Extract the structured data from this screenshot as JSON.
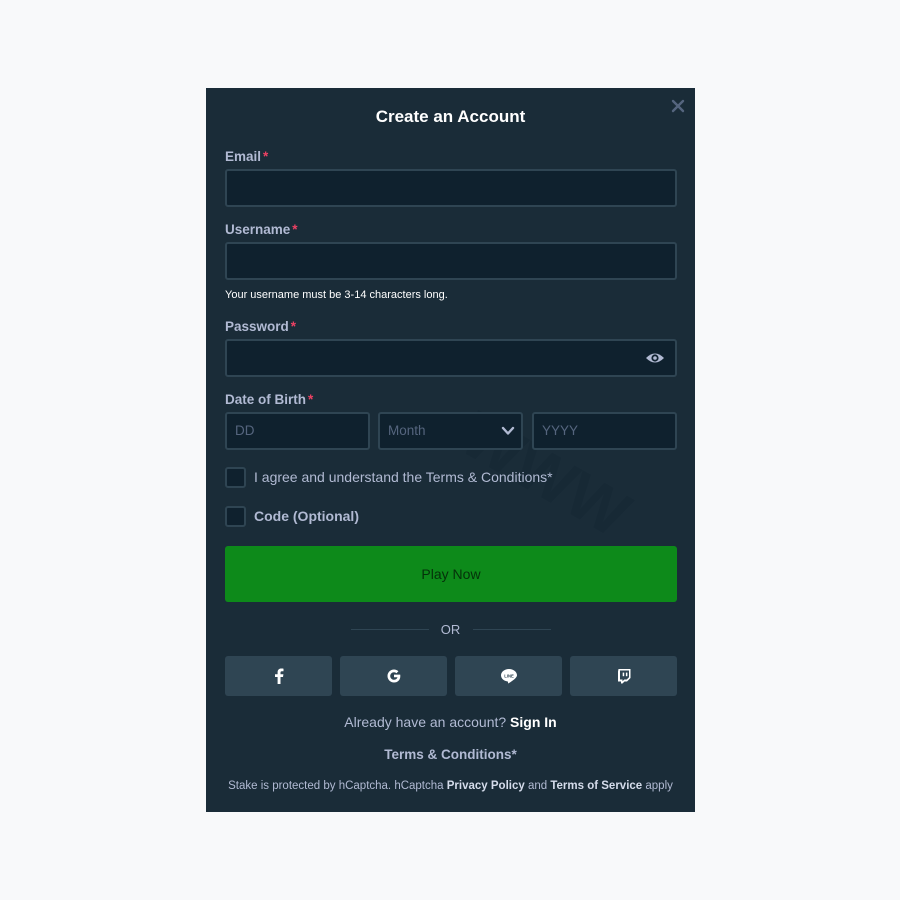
{
  "modal": {
    "title": "Create an Account",
    "close_icon": "close-icon"
  },
  "form": {
    "email_label": "Email",
    "username_label": "Username",
    "username_hint": "Your username must be 3-14 characters long.",
    "password_label": "Password",
    "password_toggle_icon": "eye-icon",
    "dob_label": "Date of Birth",
    "required_marker": "*",
    "dob_day_placeholder": "DD",
    "dob_month_placeholder": "Month",
    "dob_year_placeholder": "YYYY",
    "terms_checkbox_label": "I agree and understand the Terms & Conditions*",
    "code_checkbox_label": "Code (Optional)",
    "submit_label": "Play Now"
  },
  "divider": {
    "label": "OR"
  },
  "social": [
    {
      "name": "facebook",
      "icon": "facebook-icon"
    },
    {
      "name": "google",
      "icon": "google-icon"
    },
    {
      "name": "line",
      "icon": "line-icon"
    },
    {
      "name": "twitch",
      "icon": "twitch-icon"
    }
  ],
  "footer": {
    "signin_prompt": "Already have an account?",
    "signin_link": "Sign In",
    "terms_link": "Terms & Conditions*",
    "captcha_prefix": "Stake is protected by hCaptcha. hCaptcha",
    "captcha_privacy": "Privacy Policy",
    "captcha_and": "and",
    "captcha_tos": "Terms of Service",
    "captcha_suffix": "apply"
  },
  "colors": {
    "modal_bg": "#1a2c38",
    "input_bg": "#0f212e",
    "border": "#2f4553",
    "label": "#b1bad3",
    "required": "#ed4163",
    "submit": "#0d8a1a"
  }
}
